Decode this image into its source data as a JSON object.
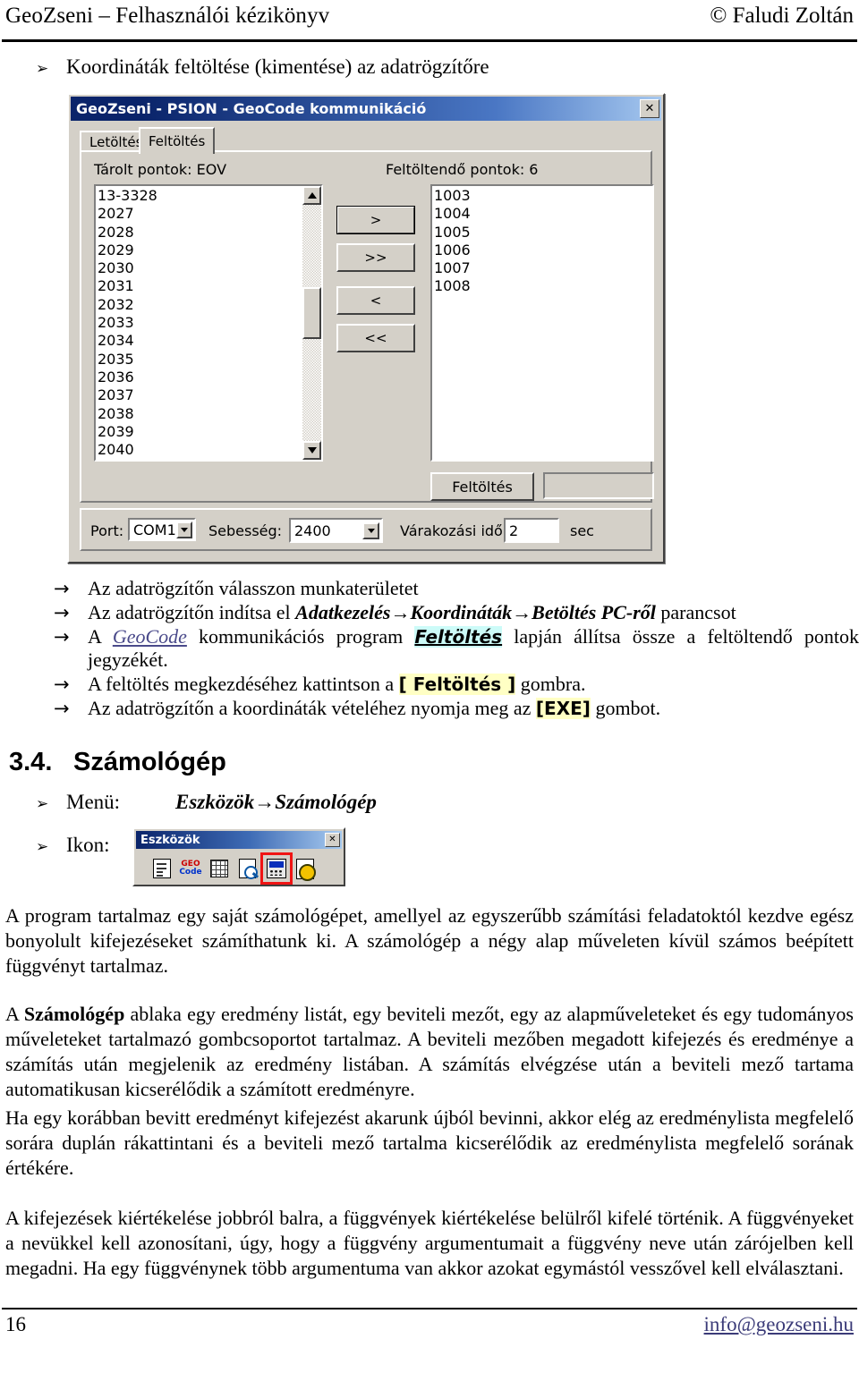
{
  "header": {
    "left": "GeoZseni – Felhasználói kézikönyv",
    "right": "© Faludi Zoltán"
  },
  "section_upload": {
    "bullet_marker": "➢",
    "heading": "Koordináták feltöltése (kimentése) az adatrögzítőre"
  },
  "dialog": {
    "title": "GeoZseni - PSION - GeoCode kommunikáció",
    "close_label": "✕",
    "tabs": [
      {
        "label": "Letöltés",
        "active": false
      },
      {
        "label": "Feltöltés",
        "active": true
      }
    ],
    "left_group_label": "Tárolt pontok:  EOV",
    "right_group_label": "Feltöltendő pontok:  6",
    "stored_points": [
      "13-3328",
      "2027",
      "2028",
      "2029",
      "2030",
      "2031",
      "2032",
      "2033",
      "2034",
      "2035",
      "2036",
      "2037",
      "2038",
      "2039",
      "2040"
    ],
    "upload_points": [
      "1003",
      "1004",
      "1005",
      "1006",
      "1007",
      "1008"
    ],
    "transfer_buttons": [
      {
        "label": ">",
        "name": "move-right-button"
      },
      {
        "label": ">>",
        "name": "move-all-right-button"
      },
      {
        "label": "<",
        "name": "move-left-button"
      },
      {
        "label": "<<",
        "name": "move-all-left-button"
      }
    ],
    "upload_button": "Feltöltés",
    "progress_value": "",
    "port_label": "Port:",
    "port_value": "COM1",
    "speed_label": "Sebesség:",
    "speed_value": "2400",
    "wait_label": "Várakozási idő:",
    "wait_value": "2",
    "wait_unit": "sec"
  },
  "steps": {
    "marker": "→",
    "items": [
      {
        "parts": [
          {
            "t": "Az adatrögzítőn válasszon munkaterületet",
            "s": "normal"
          }
        ]
      },
      {
        "parts": [
          {
            "t": "Az adatrögzítőn indítsa el ",
            "s": "normal"
          },
          {
            "t": "Adatkezelés→Koordináták→Betöltés PC-ről",
            "s": "bold-italic"
          },
          {
            "t": " parancsot",
            "s": "normal"
          }
        ]
      },
      {
        "parts": [
          {
            "t": "A ",
            "s": "normal"
          },
          {
            "t": "GeoCode",
            "s": "link"
          },
          {
            "t": " kommunikációs program ",
            "s": "normal"
          },
          {
            "t": "Feltöltés",
            "s": "hl-cyan"
          },
          {
            "t": " lapján állítsa össze a feltöltendő pontok jegyzékét.",
            "s": "normal"
          }
        ]
      },
      {
        "parts": [
          {
            "t": "A feltöltés megkezdéséhez kattintson a ",
            "s": "normal"
          },
          {
            "t": "[ Feltöltés ]",
            "s": "hl-yellow"
          },
          {
            "t": " gombra.",
            "s": "normal"
          }
        ]
      },
      {
        "parts": [
          {
            "t": "Az adatrögzítőn a koordináták vételéhez nyomja meg az ",
            "s": "normal"
          },
          {
            "t": "[EXE]",
            "s": "hl-yellow"
          },
          {
            "t": " gombot.",
            "s": "normal"
          }
        ]
      }
    ]
  },
  "section34": {
    "number": "3.4.",
    "title": "Számológép",
    "bullet_marker": "➢",
    "menu_label": "Menü:",
    "menu_value": "Eszközök→Számológép",
    "icon_label": "Ikon:"
  },
  "toolbar_window": {
    "title": "Eszközök",
    "close_label": "✕",
    "icons": [
      {
        "name": "report-document-icon",
        "selected": false
      },
      {
        "name": "geocode-icon",
        "label_top": "GEO",
        "label_bottom": "Code",
        "selected": false
      },
      {
        "name": "grid-table-icon",
        "selected": false
      },
      {
        "name": "document-preview-icon",
        "selected": false
      },
      {
        "name": "calculator-icon",
        "selected": true
      },
      {
        "name": "document-settings-icon",
        "selected": false
      }
    ],
    "selection_color": "#f01414"
  },
  "paragraphs": [
    {
      "text": "A program tartalmaz egy saját számológépet, amellyel az egyszerűbb számítási feladatoktól kezdve egész bonyolult kifejezéseket számíthatunk ki. A számológép a négy alap műveleten kívül számos beépített függvényt tartalmaz."
    },
    {
      "pre": "A ",
      "bold": "Számológép",
      "post": " ablaka egy eredmény listát, egy beviteli mezőt, egy az alapműveleteket és egy tudományos műveleteket tartalmazó gombcsoportot tartalmaz. A beviteli mezőben megadott kifejezés és eredménye a számítás után megjelenik az eredmény listában. A számítás elvégzése után a beviteli mező tartama automatikusan kicserélődik a számított eredményre."
    },
    {
      "text": "Ha egy korábban bevitt eredményt kifejezést akarunk újból bevinni, akkor elég az eredménylista megfelelő sorára duplán rákattintani és a beviteli mező tartalma kicserélődik az eredménylista megfelelő sorának értékére."
    },
    {
      "text": "A kifejezések kiértékelése jobbról balra, a függvények kiértékelése belülről kifelé történik. A függvényeket a nevükkel kell azonosítani, úgy, hogy a függvény argumentumait a függvény neve után zárójelben kell megadni. Ha egy függvénynek több argumentuma van akkor azokat egymástól vesszővel kell elválasztani."
    }
  ],
  "footer": {
    "page": "16",
    "email": "info@geozseni.hu"
  }
}
